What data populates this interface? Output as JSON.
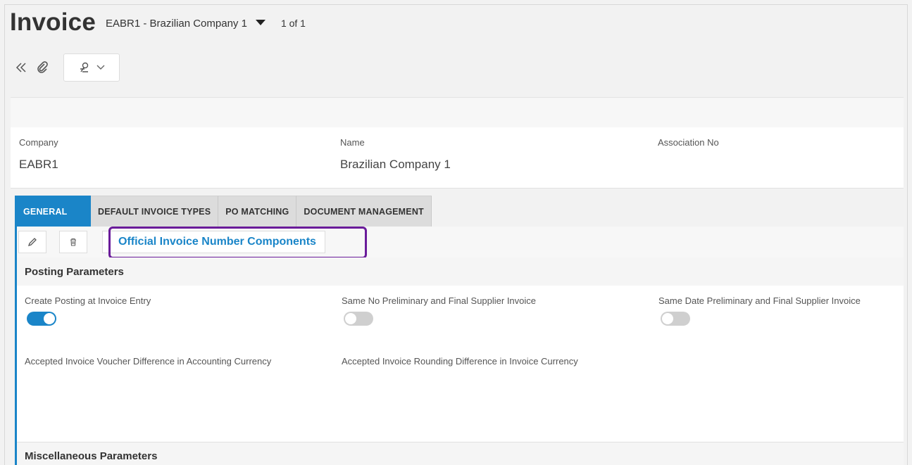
{
  "header": {
    "title": "Invoice",
    "record_selector": "EABR1 - Brazilian Company 1",
    "record_count": "1 of 1"
  },
  "toolbar": {
    "collapse_icon": "double-chevron-left-icon",
    "attachment_icon": "paperclip-icon",
    "workflow_icon": "workflow-icon"
  },
  "company_card": {
    "company_label": "Company",
    "company_value": "EABR1",
    "name_label": "Name",
    "name_value": "Brazilian Company 1",
    "association_label": "Association No",
    "association_value": ""
  },
  "tabs": [
    {
      "label": "GENERAL",
      "active": true
    },
    {
      "label": "DEFAULT INVOICE TYPES",
      "active": false
    },
    {
      "label": "PO MATCHING",
      "active": false
    },
    {
      "label": "DOCUMENT MANAGEMENT",
      "active": false
    }
  ],
  "commands": {
    "edit_icon": "pencil-icon",
    "delete_icon": "trash-icon",
    "link_label": "Official Invoice Number Components"
  },
  "posting": {
    "title": "Posting Parameters",
    "create_posting_label": "Create Posting at Invoice Entry",
    "create_posting_on": true,
    "same_no_label": "Same No Preliminary and Final Supplier Invoice",
    "same_no_on": false,
    "same_date_label": "Same Date Preliminary and Final Supplier Invoice",
    "same_date_on": false,
    "voucher_diff_label": "Accepted Invoice Voucher Difference in Accounting Currency",
    "voucher_diff_value": "",
    "rounding_diff_label": "Accepted Invoice Rounding Difference in Invoice Currency",
    "rounding_diff_value": ""
  },
  "misc": {
    "title": "Miscellaneous Parameters"
  },
  "colors": {
    "accent": "#1a85c8",
    "highlight": "#6a1b9a"
  }
}
